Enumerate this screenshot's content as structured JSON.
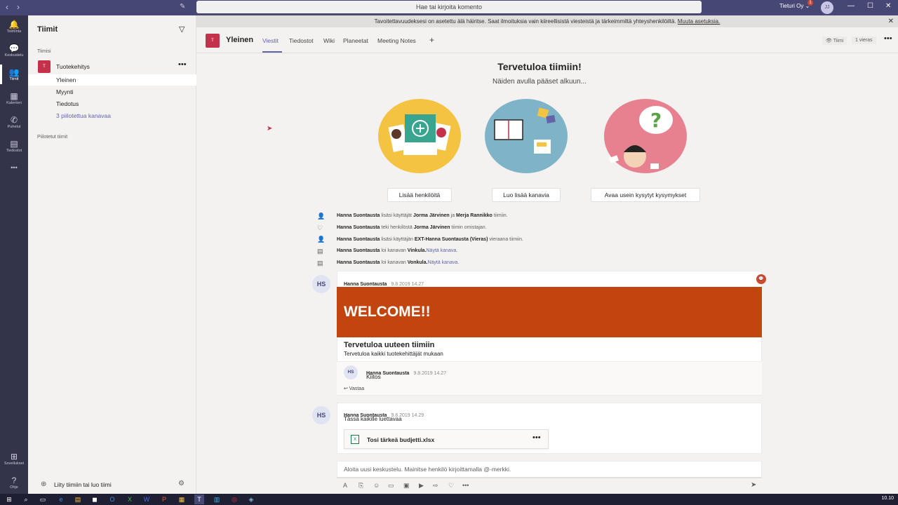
{
  "titlebar": {
    "back": "‹",
    "forward": "›",
    "compose_icon": "compose-icon",
    "search_placeholder": "Hae tai kirjoita komento",
    "tenant": "Tieturi Oy ⌄",
    "badge": "1",
    "avatar": "JJ",
    "minimize": "—",
    "maximize": "☐",
    "close": "✕"
  },
  "notification": {
    "text": "Tavoitettavuudeksesi on asetettu älä häiritse. Saat ilmoituksia vain kiireellisistä viesteistä ja tärkeimmiltä yhteyshenkilöiltä.",
    "link": "Muuta asetuksia.",
    "close": "✕"
  },
  "appbar": {
    "items": [
      {
        "label": "Toiminta",
        "icon": "🔔"
      },
      {
        "label": "Keskustelu",
        "icon": "💬"
      },
      {
        "label": "Tiimit",
        "icon": "👥"
      },
      {
        "label": "Kalenteri",
        "icon": "▦"
      },
      {
        "label": "Puhelut",
        "icon": "✆"
      },
      {
        "label": "Tiedostot",
        "icon": "▤"
      }
    ],
    "more": "•••",
    "apps": {
      "label": "Sovellukset",
      "icon": "⊞"
    },
    "help": {
      "label": "Ohje",
      "icon": "?"
    }
  },
  "sidebar": {
    "title": "Tiimit",
    "section": "Tiimisi",
    "team": {
      "initial": "T",
      "name": "Tuotekehitys",
      "more": "•••"
    },
    "channels": [
      {
        "label": "Yleinen"
      },
      {
        "label": "Myynti"
      },
      {
        "label": "Tiedotus"
      },
      {
        "label": "3 piilotettua kanavaa"
      }
    ],
    "hidden_teams": "Piilotetut tiimit",
    "join": "Liity tiimiin tai luo tiimi"
  },
  "channel_header": {
    "initial": "T",
    "name": "Yleinen",
    "tabs": [
      {
        "label": "Viestit"
      },
      {
        "label": "Tiedostot"
      },
      {
        "label": "Wiki"
      },
      {
        "label": "Planeetat"
      },
      {
        "label": "Meeting Notes"
      },
      {
        "label": "+"
      }
    ],
    "team_btn": "👁 Tiimi",
    "guest_btn": "1 vieras",
    "more": "•••"
  },
  "welcome": {
    "title": "Tervetuloa tiimiin!",
    "subtitle": "Näiden avulla pääset alkuun...",
    "buttons": [
      "Lisää henkilöitä",
      "Luo lisää kanavia",
      "Avaa usein kysytyt kysymykset"
    ],
    "illustration_colors": [
      "#f5c342",
      "#7fb4c8",
      "#e8818f"
    ]
  },
  "activity": [
    {
      "icon": "👤",
      "actor": "Hanna Suontausta",
      "t1": "lisäsi käyttäjät",
      "b1": "Jorma Järvinen",
      "t2": "ja",
      "b2": "Merja Rannikko",
      "t3": "tiimiin.",
      "link": ""
    },
    {
      "icon": "♡",
      "actor": "Hanna Suontausta",
      "t1": "teki henkilöstä",
      "b1": "Jorma Järvinen",
      "t2": "tiimin omistajan.",
      "b2": "",
      "t3": "",
      "link": ""
    },
    {
      "icon": "👤",
      "actor": "Hanna Suontausta",
      "t1": "lisäsi käyttäjän",
      "b1": "EXT-Hanna Suontausta (Vieras)",
      "t2": "vieraana tiimiin.",
      "b2": "",
      "t3": "",
      "link": ""
    },
    {
      "icon": "▤",
      "actor": "Hanna Suontausta",
      "t1": "loi kanavan",
      "b1": "Vinkula.",
      "t2": "",
      "b2": "",
      "t3": "",
      "link": "Näytä kanava."
    },
    {
      "icon": "▤",
      "actor": "Hanna Suontausta",
      "t1": "loi kanavan",
      "b1": "Vonkula.",
      "t2": "",
      "b2": "",
      "t3": "",
      "link": "Näytä kanava."
    }
  ],
  "post1": {
    "avatar": "HS",
    "author": "Hanna Suontausta",
    "date": "9.8.2019 14.27",
    "banner": "WELCOME!!",
    "banner_color": "#c2450f",
    "title": "Tervetuloa uuteen tiimiin",
    "subtitle": "Tervetuloa kaikki tuotekehittäjät mukaan",
    "reaction": "💬",
    "reply": {
      "avatar": "HS",
      "author": "Hanna Suontausta",
      "date": "9.8.2019 14.27",
      "text": "Kiitos"
    },
    "reply_btn": "↩ Vastaa"
  },
  "post2": {
    "avatar": "HS",
    "author": "Hanna Suontausta",
    "date": "9.8.2019 14.29",
    "text": "Tässä kaikille luettavaa",
    "file": {
      "icon": "X",
      "name": "Tosi tärkeä budjetti.xlsx",
      "more": "•••"
    }
  },
  "composer": {
    "placeholder": "Aloita uusi keskustelu. Mainitse henkilö kirjoittamalla @-merkki.",
    "tools": [
      "A",
      "⎘",
      "☺",
      "▭",
      "▣",
      "▶",
      "⇨",
      "♡",
      "•••"
    ],
    "send": "➤"
  },
  "taskbar": {
    "icons": [
      "⊞",
      "⌕",
      "▭",
      "e",
      "▤",
      "◼",
      "O",
      "X",
      "W",
      "P",
      "▦",
      "T",
      "▥",
      "◎",
      "◈"
    ],
    "clock": "10.10"
  }
}
